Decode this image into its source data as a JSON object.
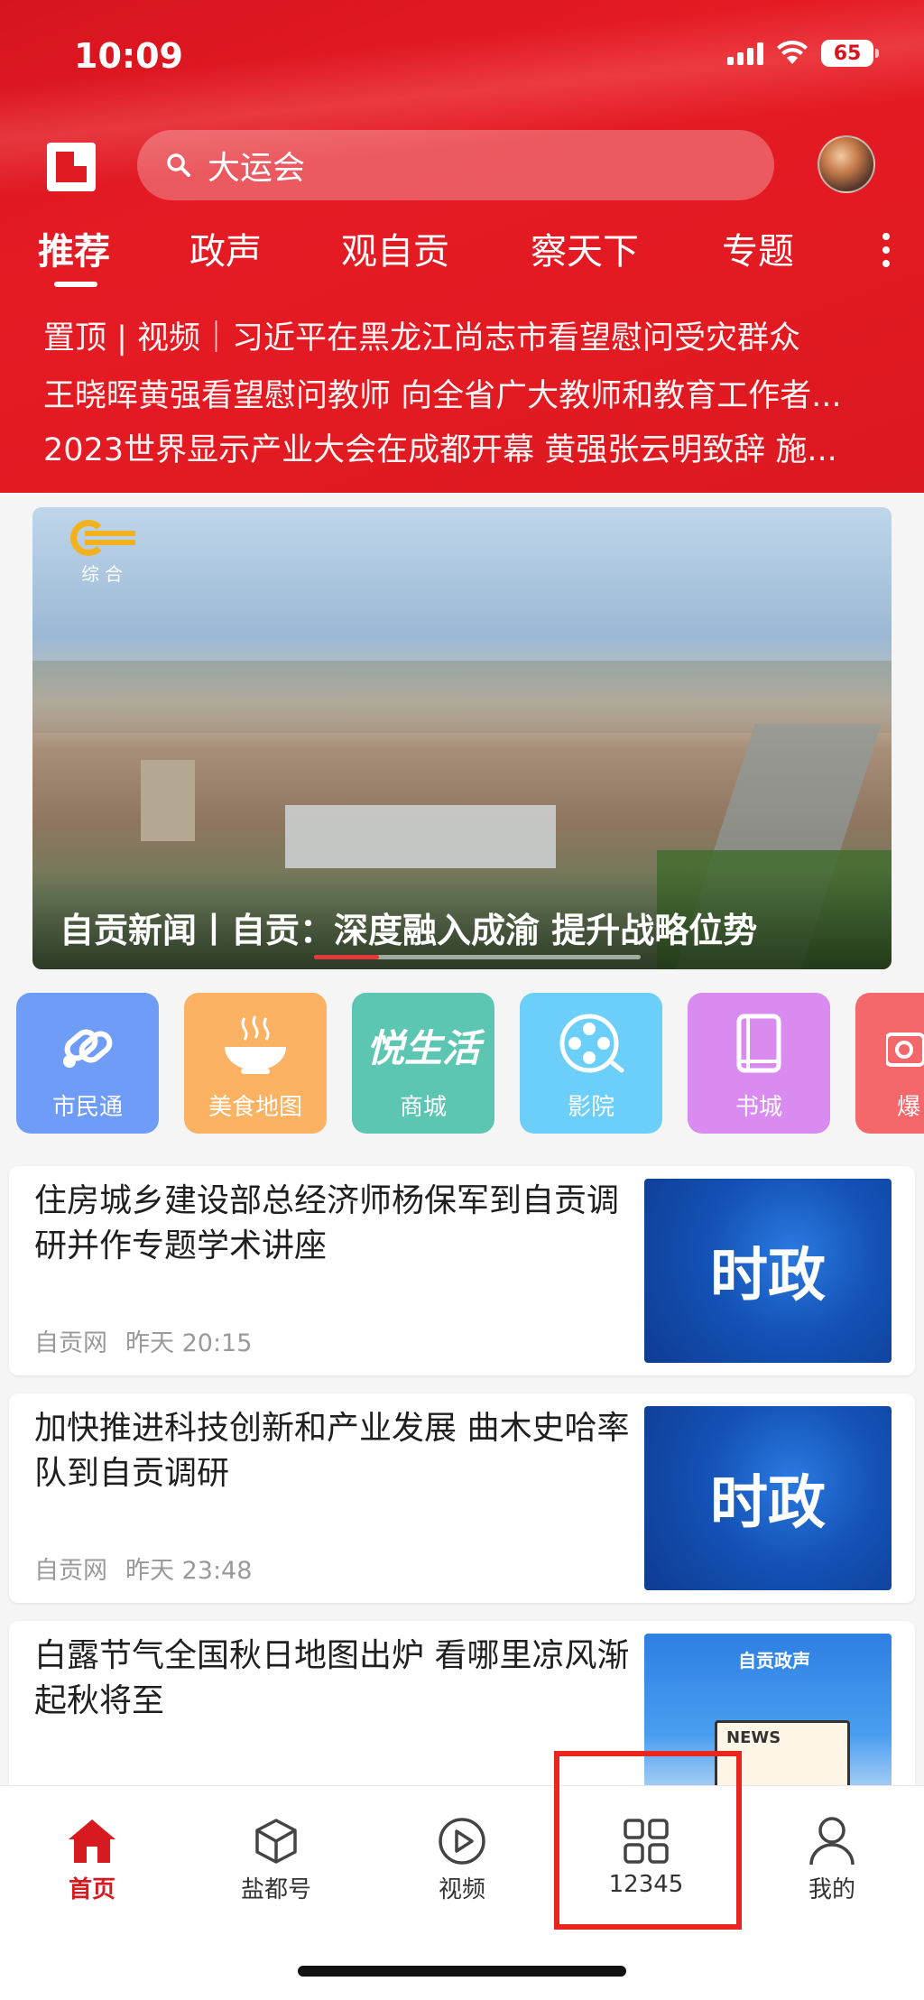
{
  "status_bar": {
    "time": "10:09",
    "battery": "65"
  },
  "header": {
    "search_text": "大运会",
    "tabs": [
      "推荐",
      "政声",
      "观自贡",
      "察天下",
      "专题"
    ],
    "headlines": [
      "置顶 | 视频｜习近平在黑龙江尚志市看望慰问受灾群众",
      "王晓晖黄强看望慰问教师 向全省广大教师和教育工作者...",
      "2023世界显示产业大会在成都开幕 黄强张云明致辞 施..."
    ]
  },
  "banner": {
    "channel_label": "综合",
    "caption": "自贡新闻丨自贡：深度融入成渝 提升战略位势",
    "progress": 0.2
  },
  "shortcuts": [
    {
      "label": "市民通",
      "color": "#6f9cf7",
      "icon": "link-icon"
    },
    {
      "label": "美食地图",
      "color": "#fbb262",
      "icon": "food-bowl-icon"
    },
    {
      "label": "商城",
      "color": "#5cc6b2",
      "icon": "yue-shenghuo-logo",
      "logo_text": "悦生活"
    },
    {
      "label": "影院",
      "color": "#6ccff9",
      "icon": "film-reel-icon"
    },
    {
      "label": "书城",
      "color": "#d98bf0",
      "icon": "book-icon"
    },
    {
      "label": "爆",
      "color": "#f4676a",
      "icon": "camera-icon"
    }
  ],
  "news": [
    {
      "title": "住房城乡建设部总经济师杨保军到自贡调研并作专题学术讲座",
      "source": "自贡网",
      "time": "昨天 20:15",
      "thumb_text": "时政"
    },
    {
      "title": "加快推进科技创新和产业发展 曲木史哈率队到自贡调研",
      "source": "自贡网",
      "time": "昨天 23:48",
      "thumb_text": "时政"
    },
    {
      "title": "白露节气全国秋日地图出炉 看哪里凉风渐起秋将至",
      "source": "",
      "time": "",
      "thumb_text": "NEWS",
      "thumb_brand": "自贡政声"
    }
  ],
  "bottom_nav": [
    {
      "label": "首页",
      "icon": "home-icon",
      "active": true
    },
    {
      "label": "盐都号",
      "icon": "cube-icon",
      "active": false
    },
    {
      "label": "视频",
      "icon": "play-circle-icon",
      "active": false
    },
    {
      "label": "12345",
      "icon": "grid-icon",
      "active": false
    },
    {
      "label": "我的",
      "icon": "person-icon",
      "active": false
    }
  ],
  "colors": {
    "primary_red": "#e11b22",
    "highlight_box": "#e8261f"
  }
}
